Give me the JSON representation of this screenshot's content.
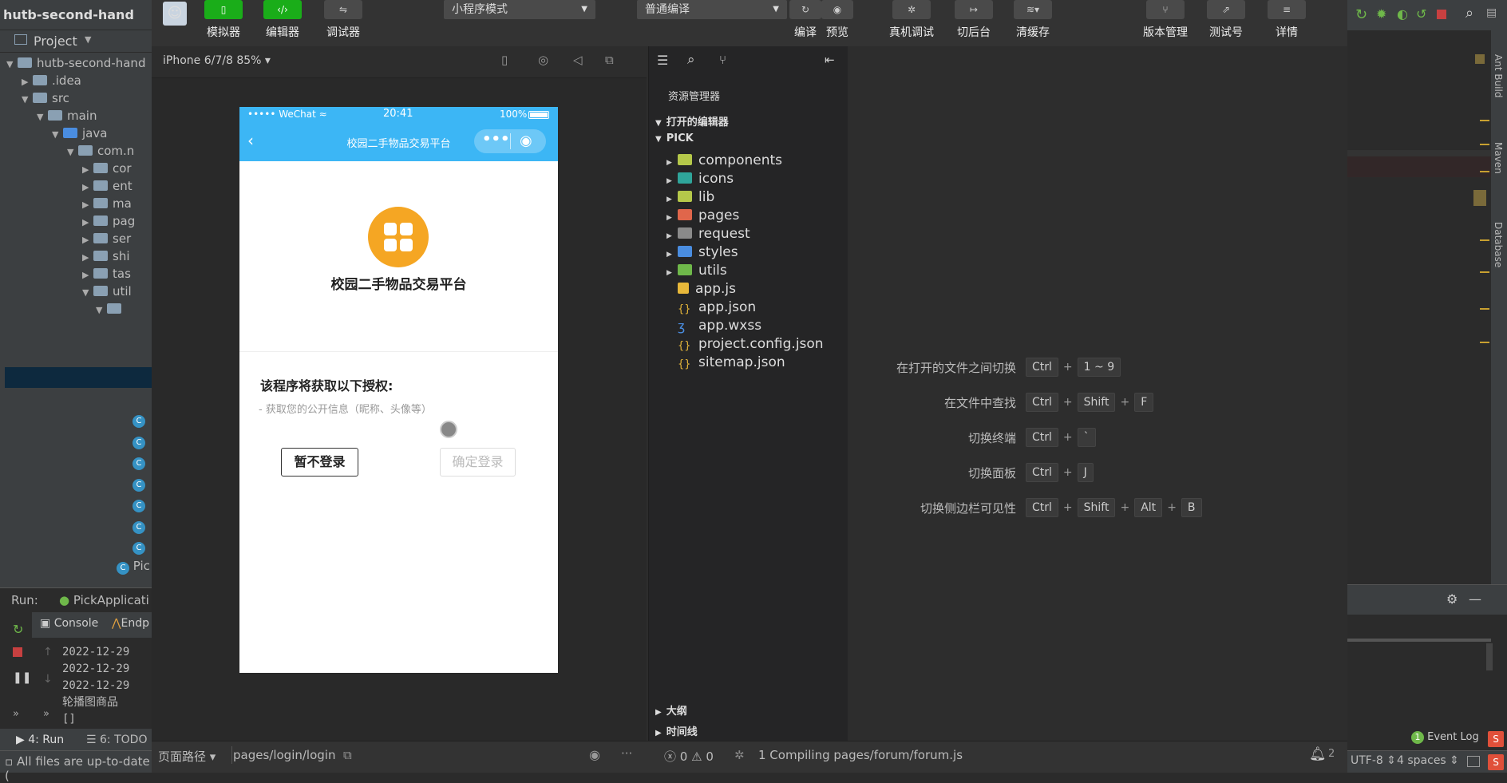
{
  "ide": {
    "project_title": "hutb-second-hand",
    "project_label": "Project",
    "tree": [
      {
        "label": "hutb-second-hand",
        "depth": 0,
        "tri": "▼"
      },
      {
        "label": ".idea",
        "depth": 1,
        "tri": "▶"
      },
      {
        "label": "src",
        "depth": 1,
        "tri": "▼"
      },
      {
        "label": "main",
        "depth": 2,
        "tri": "▼"
      },
      {
        "label": "java",
        "depth": 3,
        "tri": "▼"
      },
      {
        "label": "com.n",
        "depth": 4,
        "tri": "▼"
      },
      {
        "label": "cor",
        "depth": 5,
        "tri": "▶"
      },
      {
        "label": "ent",
        "depth": 5,
        "tri": "▶"
      },
      {
        "label": "ma",
        "depth": 5,
        "tri": "▶"
      },
      {
        "label": "pag",
        "depth": 5,
        "tri": "▶"
      },
      {
        "label": "ser",
        "depth": 5,
        "tri": "▶"
      },
      {
        "label": "shi",
        "depth": 5,
        "tri": "▶"
      },
      {
        "label": "tas",
        "depth": 5,
        "tri": "▶"
      },
      {
        "label": "util",
        "depth": 5,
        "tri": "▼"
      }
    ],
    "pic_label": "Pic",
    "run_label": "Run:",
    "run_config": "PickApplicati",
    "console_tab": "Console",
    "endp_tab": "Endp",
    "console_lines": [
      "2022-12-29",
      "2022-12-29",
      "2022-12-29",
      "轮播图商品",
      "[]"
    ],
    "run_tab": "4: Run",
    "todo_tab": "6: TODO",
    "status_text": "All files are up-to-date (",
    "encoding": "UTF-8",
    "indent": "4 spaces",
    "event_log": "Event Log",
    "event_count": "1",
    "right_tabs": [
      "Ant Build",
      "Maven",
      "Database"
    ]
  },
  "toolbar": {
    "buttons": [
      {
        "label": "模拟器",
        "icon": "phone-icon",
        "active": true
      },
      {
        "label": "编辑器",
        "icon": "code-icon",
        "active": true
      },
      {
        "label": "调试器",
        "icon": "debug-icon",
        "active": false
      }
    ],
    "mode_select": "小程序模式",
    "compile_select": "普通编译",
    "right_buttons": [
      {
        "label": "编译",
        "icon": "refresh-icon"
      },
      {
        "label": "预览",
        "icon": "eye-icon"
      },
      {
        "label": "真机调试",
        "icon": "bug-icon"
      },
      {
        "label": "切后台",
        "icon": "background-icon"
      },
      {
        "label": "清缓存",
        "icon": "layers-icon"
      },
      {
        "label": "版本管理",
        "icon": "branch-icon"
      },
      {
        "label": "测试号",
        "icon": "external-icon"
      },
      {
        "label": "详情",
        "icon": "menu-icon"
      }
    ]
  },
  "simulator": {
    "device": "iPhone 6/7/8 85%",
    "status_left": "••••• WeChat",
    "status_time": "20:41",
    "status_battery": "100%",
    "nav_title": "校园二手物品交易平台",
    "app_name": "校园二手物品交易平台",
    "auth_title": "该程序将获取以下授权:",
    "auth_item": "- 获取您的公开信息（昵称、头像等）",
    "cancel_button": "暂不登录",
    "confirm_button": "确定登录"
  },
  "explorer": {
    "header": "资源管理器",
    "open_editors": "打开的编辑器",
    "root": "PICK",
    "items": [
      {
        "label": "components",
        "type": "folder",
        "color": "#b5c84a"
      },
      {
        "label": "icons",
        "type": "folder",
        "color": "#2fa59a"
      },
      {
        "label": "lib",
        "type": "folder",
        "color": "#b5c84a"
      },
      {
        "label": "pages",
        "type": "folder",
        "color": "#e0664b"
      },
      {
        "label": "request",
        "type": "folder",
        "color": "#8a8a8a"
      },
      {
        "label": "styles",
        "type": "folder",
        "color": "#4a8de0"
      },
      {
        "label": "utils",
        "type": "folder",
        "color": "#6fb84a"
      },
      {
        "label": "app.js",
        "type": "js"
      },
      {
        "label": "app.json",
        "type": "json"
      },
      {
        "label": "app.wxss",
        "type": "css"
      },
      {
        "label": "project.config.json",
        "type": "json"
      },
      {
        "label": "sitemap.json",
        "type": "json"
      }
    ],
    "outline": "大纲",
    "timeline": "时间线"
  },
  "shortcuts": [
    {
      "label": "在打开的文件之间切换",
      "keys": [
        "Ctrl",
        "1 ~ 9"
      ]
    },
    {
      "label": "在文件中查找",
      "keys": [
        "Ctrl",
        "Shift",
        "F"
      ]
    },
    {
      "label": "切换终端",
      "keys": [
        "Ctrl",
        "`"
      ]
    },
    {
      "label": "切换面板",
      "keys": [
        "Ctrl",
        "J"
      ]
    },
    {
      "label": "切换侧边栏可见性",
      "keys": [
        "Ctrl",
        "Shift",
        "Alt",
        "B"
      ]
    }
  ],
  "dev_status": {
    "page_path_label": "页面路径",
    "page_path": "pages/login/login",
    "errors": "0",
    "warnings": "0",
    "compiling": "1 Compiling pages/forum/forum.js",
    "notifications": "2"
  }
}
